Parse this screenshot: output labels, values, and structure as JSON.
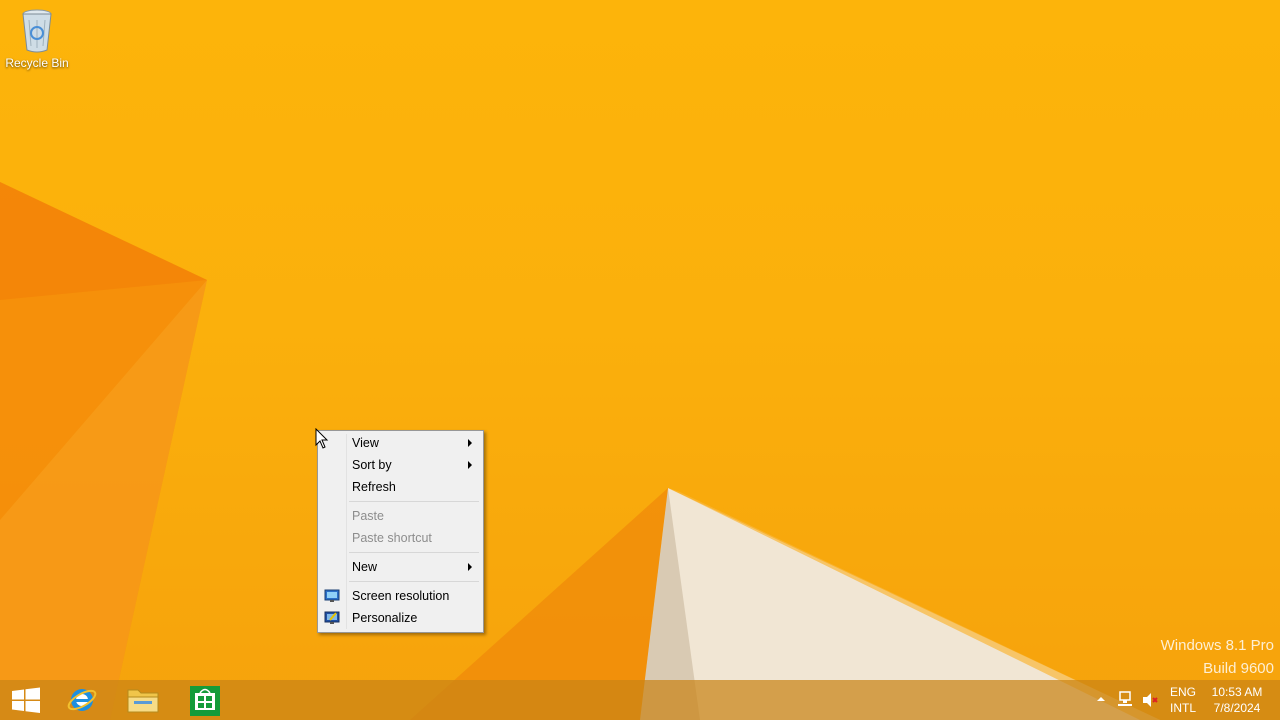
{
  "desktop": {
    "recycle_bin_label": "Recycle Bin",
    "watermark": {
      "line1": "Windows 8.1 Pro",
      "line2": "Build 9600"
    }
  },
  "context_menu": {
    "items": [
      {
        "label": "View",
        "submenu": true,
        "enabled": true
      },
      {
        "label": "Sort by",
        "submenu": true,
        "enabled": true
      },
      {
        "label": "Refresh",
        "submenu": false,
        "enabled": true
      },
      {
        "label": "Paste",
        "submenu": false,
        "enabled": false
      },
      {
        "label": "Paste shortcut",
        "submenu": false,
        "enabled": false
      },
      {
        "label": "New",
        "submenu": true,
        "enabled": true
      },
      {
        "label": "Screen resolution",
        "submenu": false,
        "enabled": true,
        "icon": "monitor-icon"
      },
      {
        "label": "Personalize",
        "submenu": false,
        "enabled": true,
        "icon": "personalize-icon"
      }
    ]
  },
  "taskbar": {
    "buttons": [
      {
        "name": "start-button",
        "icon": "windows-logo-icon"
      },
      {
        "name": "internet-explorer-button",
        "icon": "internet-explorer-icon"
      },
      {
        "name": "file-explorer-button",
        "icon": "folder-icon"
      },
      {
        "name": "store-button",
        "icon": "store-icon"
      }
    ],
    "tray": {
      "language_line1": "ENG",
      "language_line2": "INTL",
      "time": "10:53 AM",
      "date": "7/8/2024"
    }
  },
  "colors": {
    "wallpaper": "#fbb00c",
    "menu_background": "#f0f0f0",
    "disabled_text": "#8d8d8d"
  }
}
